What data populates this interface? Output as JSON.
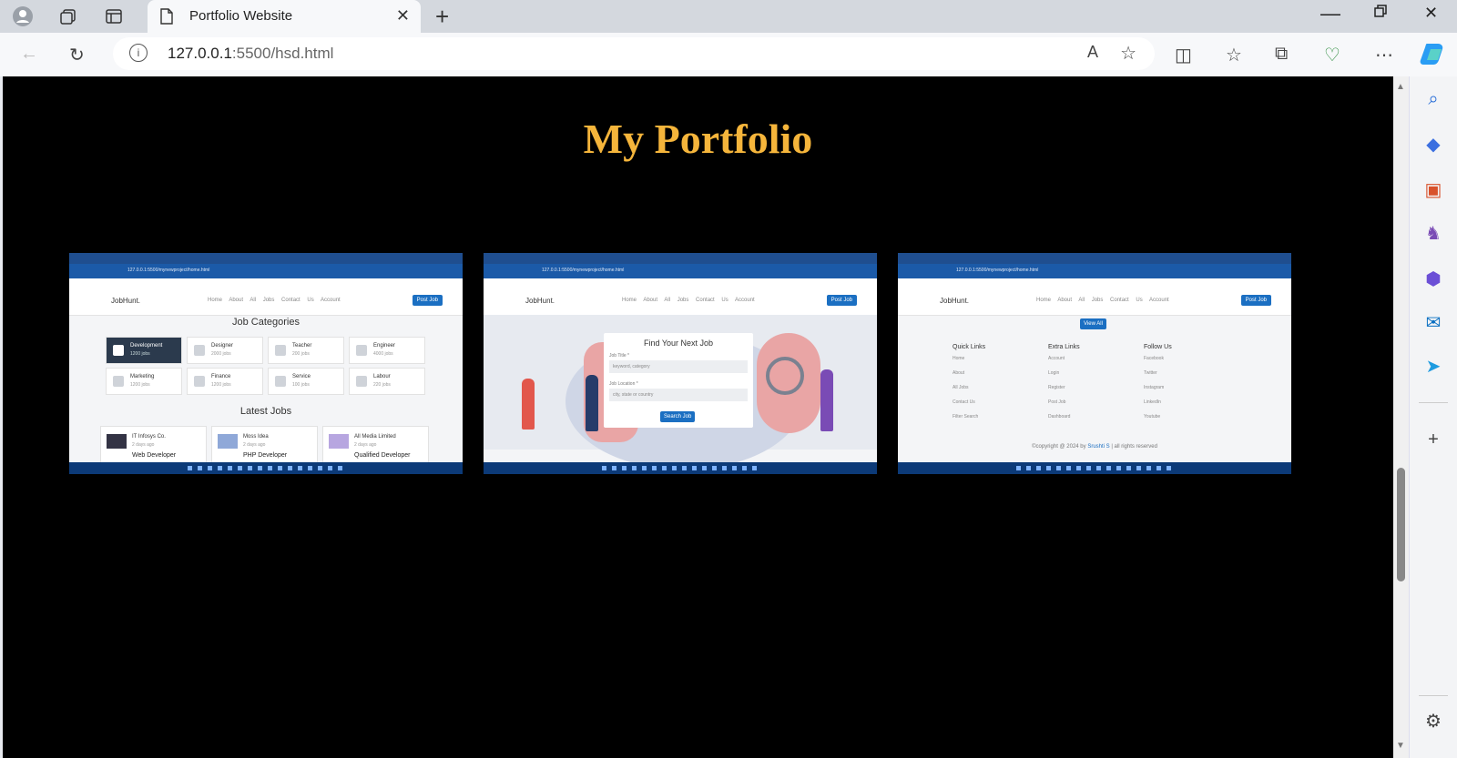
{
  "browser": {
    "tab_title": "Portfolio Website",
    "url_host": "127.0.0.1",
    "url_rest": ":5500/hsd.html",
    "new_tab": "+",
    "close": "✕"
  },
  "page": {
    "title": "My Portfolio",
    "title_color": "#f5b53b",
    "background": "#000000"
  },
  "shot1": {
    "url": "127.0.0.1:5500/mynewproject/home.html",
    "logo": "JobHunt.",
    "menu": "Home About All Jobs Contact Us Account",
    "post_job": "Post Job",
    "categories_title": "Job Categories",
    "categories": [
      {
        "name": "Development",
        "count": "1200 jobs"
      },
      {
        "name": "Designer",
        "count": "2000 jobs"
      },
      {
        "name": "Teacher",
        "count": "200 jobs"
      },
      {
        "name": "Engineer",
        "count": "4000 jobs"
      },
      {
        "name": "Marketing",
        "count": "1200 jobs"
      },
      {
        "name": "Finance",
        "count": "1200 jobs"
      },
      {
        "name": "Service",
        "count": "100 jobs"
      },
      {
        "name": "Labour",
        "count": "220 jobs"
      }
    ],
    "latest_title": "Latest Jobs",
    "jobs": [
      {
        "company": "IT Infosys Co.",
        "time": "2 days ago",
        "role": "Web Developer"
      },
      {
        "company": "Moss Idea",
        "time": "2 days ago",
        "role": "PHP Developer"
      },
      {
        "company": "All Media Limited",
        "time": "2 days ago",
        "role": "Qualified Developer"
      }
    ]
  },
  "shot2": {
    "url": "127.0.0.1:5500/mynewproject/home.html",
    "logo": "JobHunt.",
    "menu": "Home About All Jobs Contact Us Account",
    "post_job": "Post Job",
    "form_title": "Find Your Next Job",
    "job_title_label": "Job Title *",
    "job_title_placeholder": "keyword, category",
    "job_location_label": "Job Location *",
    "job_location_placeholder": "city, state or country",
    "search_button": "Search Job"
  },
  "shot3": {
    "url": "127.0.0.1:5500/mynewproject/home.html",
    "logo": "JobHunt.",
    "menu": "Home About All Jobs Contact Us Account",
    "post_job": "Post Job",
    "view_all": "View All",
    "quick_links_title": "Quick Links",
    "quick_links": [
      "Home",
      "About",
      "All Jobs",
      "Contact Us",
      "Filter Search"
    ],
    "extra_links_title": "Extra Links",
    "extra_links": [
      "Account",
      "Login",
      "Register",
      "Post Job",
      "Dashboard"
    ],
    "follow_title": "Follow Us",
    "follow_links": [
      "Facebook",
      "Twitter",
      "Instagram",
      "LinkedIn",
      "Youtube"
    ],
    "copyright_prefix": "©copyright @ 2024 by ",
    "copyright_author": "Srushti S",
    "copyright_suffix": " | all rights reserved"
  }
}
